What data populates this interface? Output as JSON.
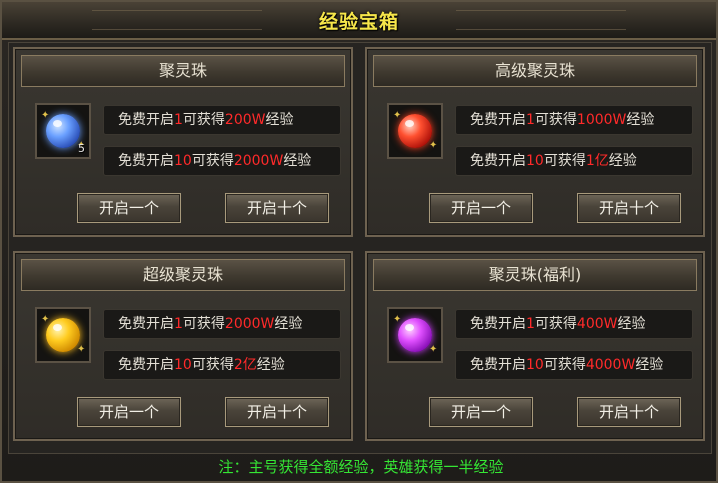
{
  "window": {
    "title": "经验宝箱"
  },
  "cards": [
    {
      "title": "聚灵珠",
      "item_count": "5",
      "orb_color": "#4a7fe0",
      "rows": [
        {
          "pre": "免费开启",
          "n": "1",
          "mid": "可获得",
          "amount": "200W",
          "post": "经验"
        },
        {
          "pre": "免费开启",
          "n": "10",
          "mid": "可获得",
          "amount": "2000W",
          "post": "经验"
        }
      ],
      "btn_one": "开启一个",
      "btn_ten": "开启十个"
    },
    {
      "title": "高级聚灵珠",
      "item_count": "",
      "orb_color": "#d8241c",
      "rows": [
        {
          "pre": "免费开启",
          "n": "1",
          "mid": "可获得",
          "amount": "1000W",
          "post": "经验"
        },
        {
          "pre": "免费开启",
          "n": "10",
          "mid": "可获得",
          "amount": "1亿",
          "post": "经验"
        }
      ],
      "btn_one": "开启一个",
      "btn_ten": "开启十个"
    },
    {
      "title": "超级聚灵珠",
      "item_count": "",
      "orb_color": "#f0b010",
      "rows": [
        {
          "pre": "免费开启",
          "n": "1",
          "mid": "可获得",
          "amount": "2000W",
          "post": "经验"
        },
        {
          "pre": "免费开启",
          "n": "10",
          "mid": "可获得",
          "amount": "2亿",
          "post": "经验"
        }
      ],
      "btn_one": "开启一个",
      "btn_ten": "开启十个"
    },
    {
      "title": "聚灵珠(福利)",
      "item_count": "",
      "orb_color": "#b020d8",
      "rows": [
        {
          "pre": "免费开启",
          "n": "1",
          "mid": "可获得",
          "amount": "400W",
          "post": "经验"
        },
        {
          "pre": "免费开启",
          "n": "10",
          "mid": "可获得",
          "amount": "4000W",
          "post": "经验"
        }
      ],
      "btn_one": "开启一个",
      "btn_ten": "开启十个"
    }
  ],
  "footer": {
    "note": "注：主号获得全额经验，英雄获得一半经验"
  },
  "colors": {
    "title": "#f6e64a",
    "highlight": "#ff2a2a",
    "note": "#35e634"
  }
}
